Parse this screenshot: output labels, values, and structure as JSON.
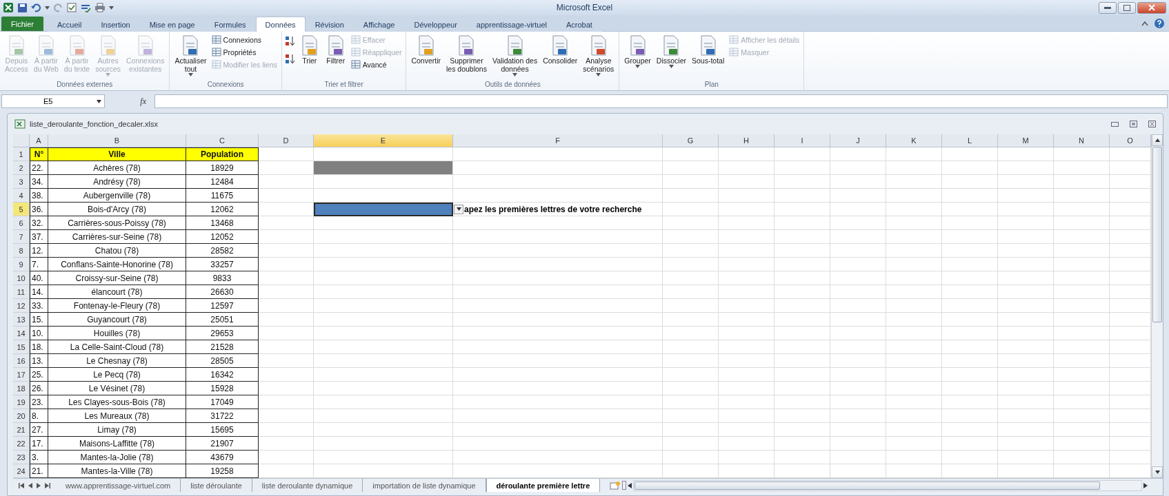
{
  "window": {
    "title": "Microsoft Excel"
  },
  "ribbon_tabs": [
    {
      "label": "Fichier",
      "kind": "file",
      "selected": false
    },
    {
      "label": "Accueil",
      "kind": "tab",
      "selected": false
    },
    {
      "label": "Insertion",
      "kind": "tab",
      "selected": false
    },
    {
      "label": "Mise en page",
      "kind": "tab",
      "selected": false
    },
    {
      "label": "Formules",
      "kind": "tab",
      "selected": false
    },
    {
      "label": "Données",
      "kind": "tab",
      "selected": true
    },
    {
      "label": "Révision",
      "kind": "tab",
      "selected": false
    },
    {
      "label": "Affichage",
      "kind": "tab",
      "selected": false
    },
    {
      "label": "Développeur",
      "kind": "tab",
      "selected": false
    },
    {
      "label": "apprentissage-virtuel",
      "kind": "tab",
      "selected": false
    },
    {
      "label": "Acrobat",
      "kind": "tab",
      "selected": false
    }
  ],
  "ribbon_groups": [
    {
      "label": "Données externes",
      "items": [
        {
          "kind": "large",
          "label": "Depuis\nAccess",
          "disabled": true
        },
        {
          "kind": "large",
          "label": "À partir\ndu Web",
          "disabled": true
        },
        {
          "kind": "large",
          "label": "À partir\ndu texte",
          "disabled": true
        },
        {
          "kind": "large",
          "label": "Autres\nsources",
          "disabled": true,
          "menu": true
        },
        {
          "kind": "large",
          "label": "Connexions\nexistantes",
          "disabled": true
        }
      ]
    },
    {
      "label": "Connexions",
      "items": [
        {
          "kind": "large",
          "label": "Actualiser\ntout",
          "disabled": false,
          "menu": true
        },
        {
          "kind": "small_stack",
          "buttons": [
            {
              "label": "Connexions",
              "disabled": false
            },
            {
              "label": "Propriétés",
              "disabled": false
            },
            {
              "label": "Modifier les liens",
              "disabled": true
            }
          ]
        }
      ]
    },
    {
      "label": "Trier et filtrer",
      "items": [
        {
          "kind": "sort_pair"
        },
        {
          "kind": "large",
          "label": "Trier",
          "disabled": false
        },
        {
          "kind": "large",
          "label": "Filtrer",
          "disabled": false
        },
        {
          "kind": "small_stack",
          "buttons": [
            {
              "label": "Effacer",
              "disabled": true
            },
            {
              "label": "Réappliquer",
              "disabled": true
            },
            {
              "label": "Avancé",
              "disabled": false
            }
          ]
        }
      ]
    },
    {
      "label": "Outils de données",
      "items": [
        {
          "kind": "large",
          "label": "Convertir",
          "disabled": false
        },
        {
          "kind": "large",
          "label": "Supprimer\nles doublons",
          "disabled": false
        },
        {
          "kind": "large",
          "label": "Validation des\ndonnées",
          "disabled": false,
          "menu": true
        },
        {
          "kind": "large",
          "label": "Consolider",
          "disabled": false
        },
        {
          "kind": "large",
          "label": "Analyse\nscénarios",
          "disabled": false,
          "menu": true
        }
      ]
    },
    {
      "label": "Plan",
      "items": [
        {
          "kind": "large",
          "label": "Grouper",
          "disabled": false,
          "menu": true
        },
        {
          "kind": "large",
          "label": "Dissocier",
          "disabled": false,
          "menu": true
        },
        {
          "kind": "large",
          "label": "Sous-total",
          "disabled": false
        },
        {
          "kind": "small_stack",
          "buttons": [
            {
              "label": "Afficher les détails",
              "disabled": true
            },
            {
              "label": "Masquer",
              "disabled": true
            }
          ]
        }
      ]
    }
  ],
  "formula_bar": {
    "name_box": "E5",
    "fx": "fx"
  },
  "workbook": {
    "title": "liste_deroulante_fonction_decaler.xlsx"
  },
  "columns": [
    {
      "label": "A",
      "selected": false
    },
    {
      "label": "B",
      "selected": false
    },
    {
      "label": "C",
      "selected": false
    },
    {
      "label": "D",
      "selected": false
    },
    {
      "label": "E",
      "selected": true
    },
    {
      "label": "F",
      "selected": false
    },
    {
      "label": "G",
      "selected": false
    },
    {
      "label": "H",
      "selected": false
    },
    {
      "label": "I",
      "selected": false
    },
    {
      "label": "J",
      "selected": false
    },
    {
      "label": "K",
      "selected": false
    },
    {
      "label": "L",
      "selected": false
    },
    {
      "label": "M",
      "selected": false
    },
    {
      "label": "N",
      "selected": false
    },
    {
      "label": "O",
      "selected": false
    }
  ],
  "rows": [
    {
      "number": "1",
      "selected": false,
      "kind": "header",
      "cells": [
        "N°",
        "Ville",
        "Population"
      ]
    },
    {
      "number": "2",
      "selected": false,
      "kind": "data",
      "cells": [
        "22.",
        "Achères (78)",
        "18929"
      ],
      "e_shaded": true
    },
    {
      "number": "3",
      "selected": false,
      "kind": "data",
      "cells": [
        "34.",
        "Andrésy (78)",
        "12484"
      ]
    },
    {
      "number": "4",
      "selected": false,
      "kind": "data",
      "cells": [
        "38.",
        "Aubergenville (78)",
        "11675"
      ]
    },
    {
      "number": "5",
      "selected": true,
      "kind": "data",
      "cells": [
        "36.",
        "Bois-d'Arcy (78)",
        "12062"
      ],
      "e_active": true,
      "f_text": "apez les premières lettres de votre recherche"
    },
    {
      "number": "6",
      "selected": false,
      "kind": "data",
      "cells": [
        "32.",
        "Carrières-sous-Poissy (78)",
        "13468"
      ]
    },
    {
      "number": "7",
      "selected": false,
      "kind": "data",
      "cells": [
        "37.",
        "Carrières-sur-Seine (78)",
        "12052"
      ]
    },
    {
      "number": "8",
      "selected": false,
      "kind": "data",
      "cells": [
        "12.",
        "Chatou (78)",
        "28582"
      ]
    },
    {
      "number": "9",
      "selected": false,
      "kind": "data",
      "cells": [
        "7.",
        "Conflans-Sainte-Honorine (78)",
        "33257"
      ]
    },
    {
      "number": "10",
      "selected": false,
      "kind": "data",
      "cells": [
        "40.",
        "Croissy-sur-Seine (78)",
        "9833"
      ]
    },
    {
      "number": "11",
      "selected": false,
      "kind": "data",
      "cells": [
        "14.",
        "élancourt (78)",
        "26630"
      ]
    },
    {
      "number": "12",
      "selected": false,
      "kind": "data",
      "cells": [
        "33.",
        "Fontenay-le-Fleury (78)",
        "12597"
      ]
    },
    {
      "number": "13",
      "selected": false,
      "kind": "data",
      "cells": [
        "15.",
        "Guyancourt (78)",
        "25051"
      ]
    },
    {
      "number": "14",
      "selected": false,
      "kind": "data",
      "cells": [
        "10.",
        "Houilles (78)",
        "29653"
      ]
    },
    {
      "number": "15",
      "selected": false,
      "kind": "data",
      "cells": [
        "18.",
        "La Celle-Saint-Cloud (78)",
        "21528"
      ]
    },
    {
      "number": "16",
      "selected": false,
      "kind": "data",
      "cells": [
        "13.",
        "Le Chesnay (78)",
        "28505"
      ]
    },
    {
      "number": "17",
      "selected": false,
      "kind": "data",
      "cells": [
        "25.",
        "Le Pecq (78)",
        "16342"
      ]
    },
    {
      "number": "18",
      "selected": false,
      "kind": "data",
      "cells": [
        "26.",
        "Le Vésinet (78)",
        "15928"
      ]
    },
    {
      "number": "19",
      "selected": false,
      "kind": "data",
      "cells": [
        "23.",
        "Les Clayes-sous-Bois (78)",
        "17049"
      ]
    },
    {
      "number": "20",
      "selected": false,
      "kind": "data",
      "cells": [
        "8.",
        "Les Mureaux (78)",
        "31722"
      ]
    },
    {
      "number": "21",
      "selected": false,
      "kind": "data",
      "cells": [
        "27.",
        "Limay (78)",
        "15695"
      ]
    },
    {
      "number": "22",
      "selected": false,
      "kind": "data",
      "cells": [
        "17.",
        "Maisons-Laffitte (78)",
        "21907"
      ]
    },
    {
      "number": "23",
      "selected": false,
      "kind": "data",
      "cells": [
        "3.",
        "Mantes-la-Jolie (78)",
        "43679"
      ]
    },
    {
      "number": "24",
      "selected": false,
      "kind": "data",
      "cells": [
        "21.",
        "Mantes-la-Ville (78)",
        "19258"
      ]
    }
  ],
  "sheet_tabs": [
    {
      "label": "www.apprentissage-virtuel.com",
      "selected": false
    },
    {
      "label": "liste déroulante",
      "selected": false
    },
    {
      "label": "liste deroulante dynamique",
      "selected": false
    },
    {
      "label": "importation de liste dynamique",
      "selected": false
    },
    {
      "label": "déroulante première lettre",
      "selected": true
    }
  ]
}
